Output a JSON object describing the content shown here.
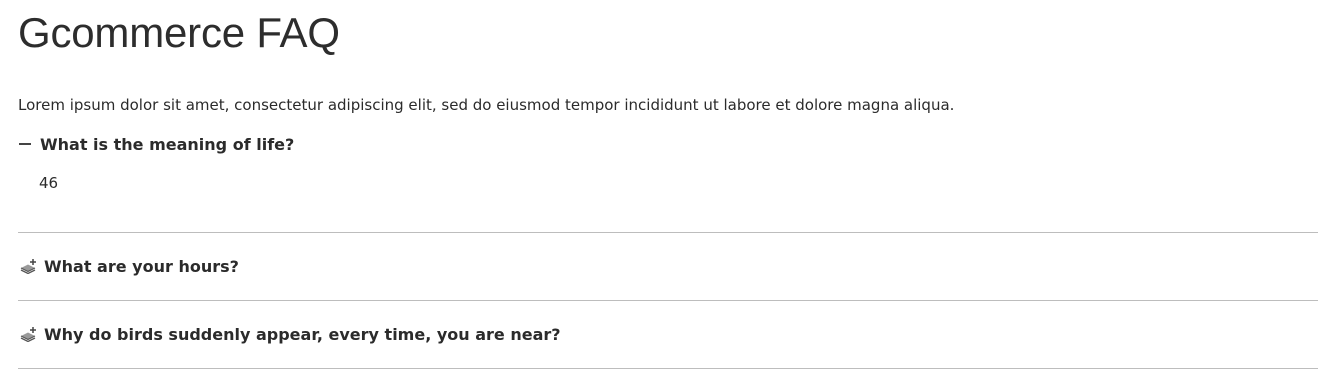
{
  "page": {
    "title": "Gcommerce FAQ",
    "intro": "Lorem ipsum dolor sit amet, consectetur adipiscing elit, sed do eiusmod tempor incididunt ut labore et dolore magna aliqua."
  },
  "faq": {
    "items": [
      {
        "question": "What is the meaning of life?",
        "answer": "46",
        "expanded": true,
        "icon": "minus-icon"
      },
      {
        "question": "What are your hours?",
        "expanded": false,
        "icon": "layers-plus-icon"
      },
      {
        "question": "Why do birds suddenly appear, every time, you are near?",
        "expanded": false,
        "icon": "layers-plus-icon"
      }
    ]
  }
}
